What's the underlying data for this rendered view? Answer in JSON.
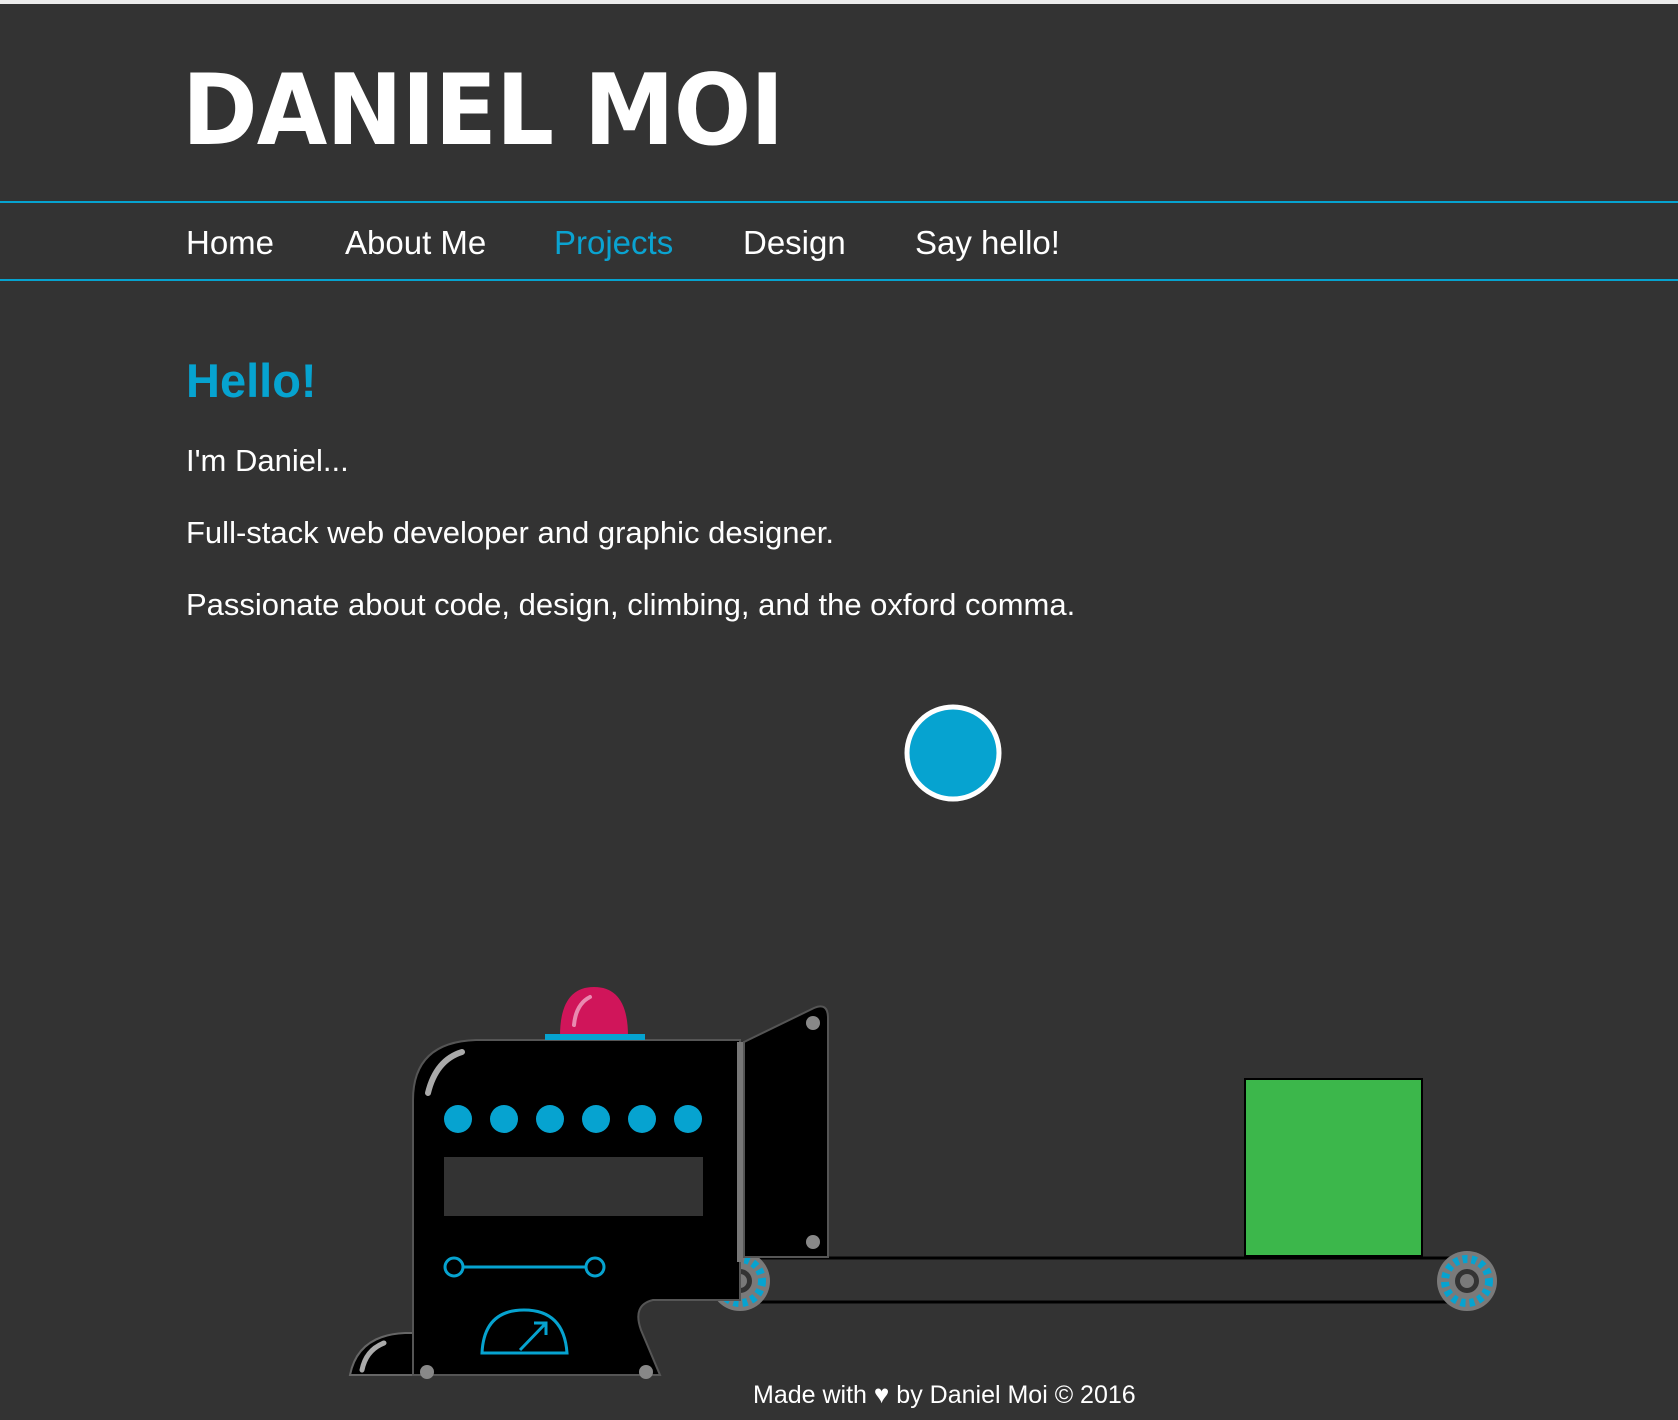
{
  "header": {
    "title": "DANIEL MOI"
  },
  "nav": {
    "items": [
      {
        "label": "Home"
      },
      {
        "label": "About Me"
      },
      {
        "label": "Projects"
      },
      {
        "label": "Design"
      },
      {
        "label": "Say hello!"
      }
    ],
    "active": "Projects"
  },
  "intro": {
    "heading": "Hello!",
    "lines": [
      "I'm Daniel...",
      "Full-stack web developer and graphic designer.",
      "Passionate about code, design, climbing, and the oxford comma."
    ]
  },
  "footer": {
    "prefix": "Made with",
    "heart": "♥",
    "suffix": "by Daniel Moi © 2016"
  },
  "colors": {
    "background": "#333333",
    "accent": "#06a3d0",
    "alarm": "#d0155a",
    "box": "#3cb74b",
    "machine": "#000000"
  }
}
